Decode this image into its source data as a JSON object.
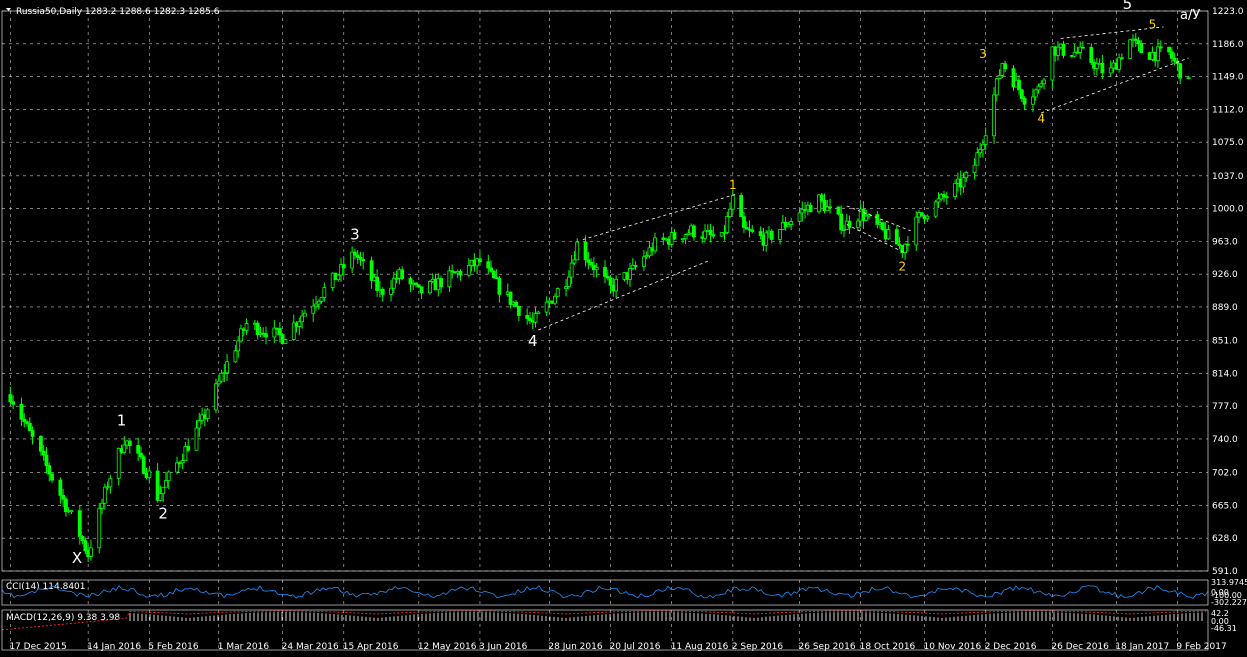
{
  "colors": {
    "background": "#000000",
    "grid": "#c8c8c8",
    "candle": "#00ff00",
    "text": "#ffffff",
    "wave_primary": "#ffffff",
    "wave_secondary": "#ffd700",
    "cci_line": "#1e90ff",
    "macd_hist": "#d8d8d8",
    "macd_signal": "#ff2a2a"
  },
  "chart_title": "Russia50,Daily  1283.2 1288.6 1282.3 1285.6",
  "corner_label": "а/У",
  "chart_data": [
    {
      "type": "candlestick",
      "title": "Russia50,Daily  1283.2 1288.6 1282.3 1285.6",
      "ylim": [
        591,
        1223
      ],
      "y_ticks": [
        "1223.0",
        "1186.0",
        "1149.0",
        "1112.0",
        "1075.0",
        "1037.0",
        "1000.0",
        "963.0",
        "926.0",
        "889.0",
        "851.0",
        "814.0",
        "777.0",
        "740.0",
        "702.0",
        "665.0",
        "628.0",
        "591.0"
      ],
      "x_ticks": [
        "17 Dec 2015",
        "14 Jan 2016",
        "5 Feb 2016",
        "1 Mar 2016",
        "24 Mar 2016",
        "15 Apr 2016",
        "12 May 2016",
        "3 Jun 2016",
        "28 Jun 2016",
        "20 Jul 2016",
        "11 Aug 2016",
        "2 Sep 2016",
        "26 Sep 2016",
        "18 Oct 2016",
        "10 Nov 2016",
        "2 Dec 2016",
        "26 Dec 2016",
        "18 Jan 2017",
        "9 Feb 2017"
      ],
      "grid": true,
      "path_anchors": [
        [
          "17 Dec 2015",
          790
        ],
        [
          "10 Jan 2016",
          640
        ],
        [
          "14 Jan 2016",
          610
        ],
        [
          "21 Jan 2016",
          690
        ],
        [
          "27 Jan 2016",
          740
        ],
        [
          "5 Feb 2016",
          700
        ],
        [
          "8 Feb 2016",
          675
        ],
        [
          "24 Feb 2016",
          760
        ],
        [
          "4 Mar 2016",
          825
        ],
        [
          "11 Mar 2016",
          870
        ],
        [
          "24 Mar 2016",
          855
        ],
        [
          "31 Mar 2016",
          880
        ],
        [
          "14 Apr 2016",
          930
        ],
        [
          "19 Apr 2016",
          950
        ],
        [
          "28 Apr 2016",
          905
        ],
        [
          "5 May 2016",
          925
        ],
        [
          "12 May 2016",
          905
        ],
        [
          "3 Jun 2016",
          940
        ],
        [
          "10 Jun 2016",
          910
        ],
        [
          "22 Jun 2016",
          870
        ],
        [
          "4 Jul 2016",
          920
        ],
        [
          "8 Jul 2016",
          960
        ],
        [
          "20 Jul 2016",
          910
        ],
        [
          "28 Jul 2016",
          930
        ],
        [
          "5 Aug 2016",
          960
        ],
        [
          "18 Aug 2016",
          975
        ],
        [
          "29 Aug 2016",
          965
        ],
        [
          "2 Sep 2016",
          1010
        ],
        [
          "6 Sep 2016",
          975
        ],
        [
          "14 Sep 2016",
          965
        ],
        [
          "26 Sep 2016",
          995
        ],
        [
          "3 Oct 2016",
          1010
        ],
        [
          "12 Oct 2016",
          980
        ],
        [
          "18 Oct 2016",
          995
        ],
        [
          "2 Nov 2016",
          955
        ],
        [
          "8 Nov 2016",
          990
        ],
        [
          "20 Nov 2016",
          1020
        ],
        [
          "27 Nov 2016",
          1040
        ],
        [
          "2 Dec 2016",
          1090
        ],
        [
          "8 Dec 2016",
          1165
        ],
        [
          "16 Dec 2016",
          1125
        ],
        [
          "21 Dec 2016",
          1135
        ],
        [
          "26 Dec 2016",
          1180
        ],
        [
          "6 Jan 2017",
          1175
        ],
        [
          "15 Jan 2017",
          1150
        ],
        [
          "23 Jan 2017",
          1190
        ],
        [
          "28 Jan 2017",
          1175
        ],
        [
          "6 Feb 2017",
          1175
        ],
        [
          "13 Feb 2017",
          1140
        ]
      ],
      "wave_labels": [
        {
          "text": "X",
          "date": "10 Jan 2016",
          "price": 600,
          "level": "primary"
        },
        {
          "text": "1",
          "date": "26 Jan 2016",
          "price": 755,
          "level": "primary"
        },
        {
          "text": "2",
          "date": "10 Feb 2016",
          "price": 650,
          "level": "primary"
        },
        {
          "text": "3",
          "date": "19 Apr 2016",
          "price": 965,
          "level": "primary"
        },
        {
          "text": "4",
          "date": "22 Jun 2016",
          "price": 845,
          "level": "primary"
        },
        {
          "text": "5",
          "date": "22 Jan 2017",
          "price": 1225,
          "level": "primary"
        },
        {
          "text": "1",
          "date": "2 Sep 2016",
          "price": 1022,
          "level": "secondary"
        },
        {
          "text": "2",
          "date": "2 Nov 2016",
          "price": 930,
          "level": "secondary"
        },
        {
          "text": "3",
          "date": "1 Dec 2016",
          "price": 1170,
          "level": "secondary"
        },
        {
          "text": "4",
          "date": "22 Dec 2016",
          "price": 1097,
          "level": "secondary"
        },
        {
          "text": "5",
          "date": "31 Jan 2017",
          "price": 1203,
          "level": "secondary"
        }
      ],
      "channels": [
        {
          "from": [
            "24 Jun 2016",
            863
          ],
          "to": [
            "25 Aug 2016",
            942
          ]
        },
        {
          "from": [
            "10 Jul 2016",
            965
          ],
          "to": [
            "4 Sep 2016",
            1017
          ]
        },
        {
          "from": [
            "13 Oct 2016",
            982
          ],
          "to": [
            "3 Nov 2016",
            950
          ]
        },
        {
          "from": [
            "13 Oct 2016",
            1003
          ],
          "to": [
            "5 Nov 2016",
            975
          ]
        },
        {
          "from": [
            "22 Dec 2016",
            1108
          ],
          "to": [
            "13 Feb 2017",
            1170
          ]
        },
        {
          "from": [
            "29 Dec 2016",
            1192
          ],
          "to": [
            "4 Feb 2017",
            1205
          ]
        }
      ]
    },
    {
      "type": "line",
      "name": "CCI(14) 114.8401",
      "y_ticks": [
        "313.9745",
        "0.00",
        "-100.00",
        "-302.227"
      ]
    },
    {
      "type": "bar",
      "name": "MACD(12,26,9) 9.38 3.98",
      "y_ticks": [
        "42.2",
        "0.00",
        "-46.31"
      ]
    }
  ]
}
